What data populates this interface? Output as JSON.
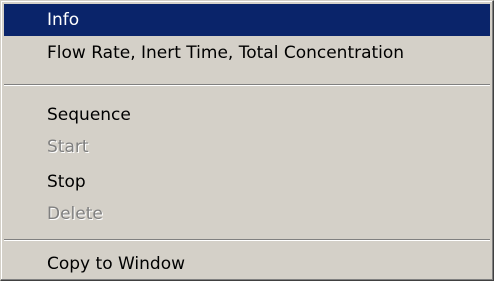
{
  "context_menu": {
    "items": [
      {
        "label": "Info",
        "state": "highlighted"
      },
      {
        "label": "Flow Rate, Inert Time, Total Concentration",
        "state": "enabled"
      },
      {
        "label": "Sequence",
        "state": "enabled"
      },
      {
        "label": "Start",
        "state": "disabled"
      },
      {
        "label": "Stop",
        "state": "enabled"
      },
      {
        "label": "Delete",
        "state": "disabled"
      },
      {
        "label": "Copy to Window",
        "state": "enabled"
      }
    ],
    "colors": {
      "menu_background": "#d4d0c8",
      "highlight_background": "#0a246a",
      "highlight_text": "#ffffff",
      "disabled_text": "#808080"
    }
  }
}
